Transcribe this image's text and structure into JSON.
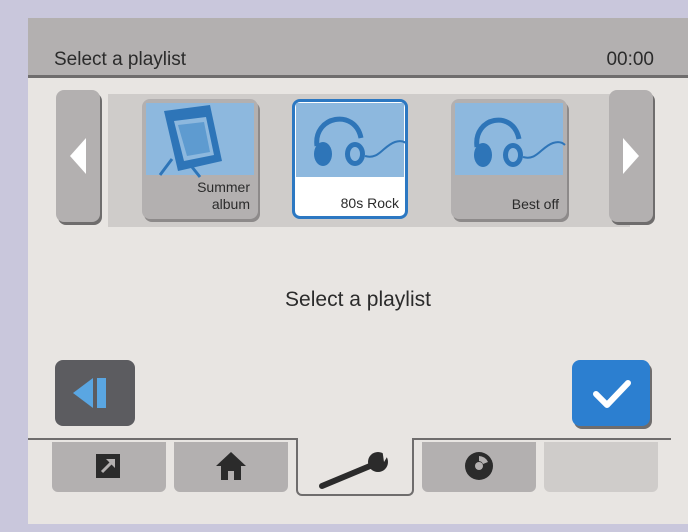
{
  "header": {
    "title": "Select a playlist",
    "time": "00:00"
  },
  "playlists": [
    {
      "label_line1": "Summer",
      "label_line2": "album",
      "icon": "picture-frame-icon",
      "selected": false
    },
    {
      "label_line1": "",
      "label_line2": "80s Rock",
      "icon": "headphones-icon",
      "selected": true
    },
    {
      "label_line1": "",
      "label_line2": "Best off",
      "icon": "headphones-icon",
      "selected": false
    }
  ],
  "message": "Select a playlist",
  "colors": {
    "accent": "#2c7fd0",
    "art_bg": "#8db8de",
    "panel": "#b3b0b0"
  },
  "tabs": [
    {
      "icon": "shortcut-arrow-icon"
    },
    {
      "icon": "home-icon"
    },
    {
      "icon": "wrench-icon",
      "active": true
    },
    {
      "icon": "disc-icon"
    },
    {
      "icon": ""
    }
  ]
}
